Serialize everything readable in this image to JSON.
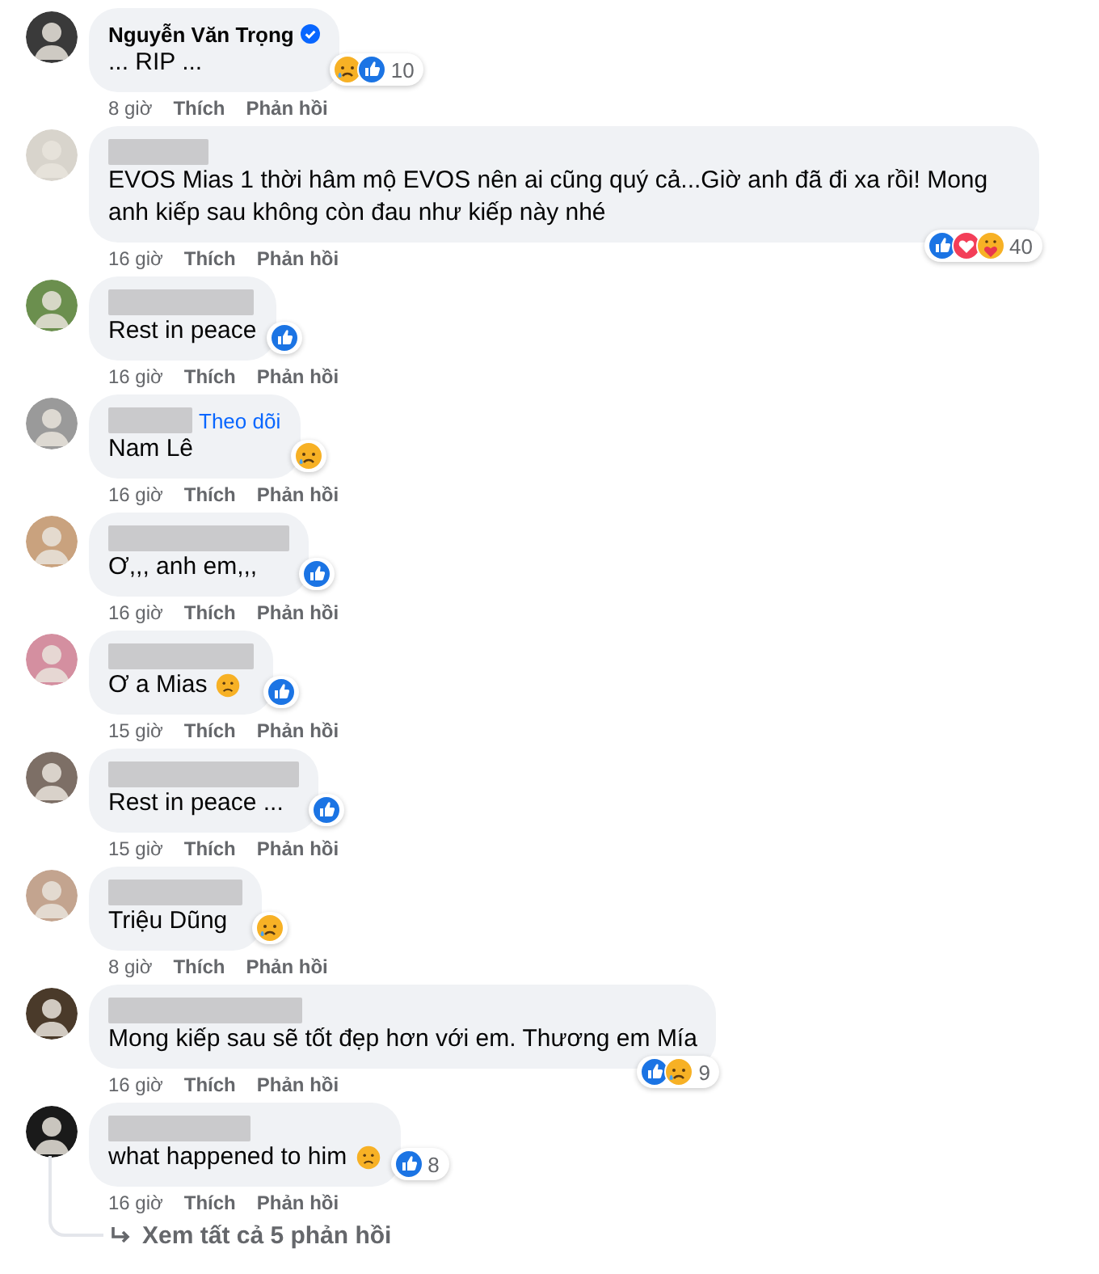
{
  "comments": [
    {
      "name_hidden": false,
      "author": "Nguyễn Văn Trọng",
      "verified": true,
      "text": "... RIP ...",
      "reactions": {
        "below_bubble": false,
        "icons": [
          {
            "kind": "sad"
          },
          {
            "kind": "like"
          }
        ],
        "count": "10"
      },
      "time": "8 giờ",
      "like": "Thích",
      "reply": "Phản hồi"
    },
    {
      "name_hidden": true,
      "text": "EVOS Mias 1 thời hâm mộ EVOS nên ai cũng quý cả...Giờ anh đã đi xa rồi! Mong anh kiếp sau không còn đau như kiếp này nhé",
      "reactions": {
        "below_bubble": true,
        "icons": [
          {
            "kind": "like"
          },
          {
            "kind": "love"
          },
          {
            "kind": "care"
          }
        ],
        "count": "40"
      },
      "time": "16 giờ",
      "like": "Thích",
      "reply": "Phản hồi"
    },
    {
      "name_hidden": true,
      "text": "Rest in peace",
      "reactions": {
        "below_bubble": false,
        "icons": [
          {
            "kind": "like"
          }
        ]
      },
      "time": "16 giờ",
      "like": "Thích",
      "reply": "Phản hồi"
    },
    {
      "name_hidden": true,
      "follow": "Theo dõi",
      "text": "Nam Lê",
      "reactions": {
        "below_bubble": false,
        "icons": [
          {
            "kind": "sad"
          }
        ]
      },
      "time": "16 giờ",
      "like": "Thích",
      "reply": "Phản hồi"
    },
    {
      "name_hidden": true,
      "text": "Ơ,,, anh em,,,",
      "reactions": {
        "below_bubble": false,
        "icons": [
          {
            "kind": "like"
          }
        ]
      },
      "time": "16 giờ",
      "like": "Thích",
      "reply": "Phản hồi"
    },
    {
      "name_hidden": true,
      "text": "Ơ a Mias",
      "emoji": {
        "kind": "frown"
      },
      "reactions": {
        "below_bubble": false,
        "icons": [
          {
            "kind": "like"
          }
        ]
      },
      "time": "15 giờ",
      "like": "Thích",
      "reply": "Phản hồi"
    },
    {
      "name_hidden": true,
      "text": "Rest in peace ...",
      "reactions": {
        "below_bubble": false,
        "icons": [
          {
            "kind": "like"
          }
        ]
      },
      "time": "15 giờ",
      "like": "Thích",
      "reply": "Phản hồi"
    },
    {
      "name_hidden": true,
      "text": "Triệu Dũng",
      "reactions": {
        "below_bubble": false,
        "icons": [
          {
            "kind": "sad"
          }
        ]
      },
      "time": "8 giờ",
      "like": "Thích",
      "reply": "Phản hồi"
    },
    {
      "name_hidden": true,
      "text": "Mong kiếp sau sẽ tốt đẹp hơn với em. Thương em Mía",
      "reactions": {
        "below_bubble": true,
        "icons": [
          {
            "kind": "like"
          },
          {
            "kind": "sad"
          }
        ],
        "count": "9"
      },
      "time": "16 giờ",
      "like": "Thích",
      "reply": "Phản hồi"
    },
    {
      "name_hidden": true,
      "text": "what happened to him",
      "emoji": {
        "kind": "frown"
      },
      "reactions": {
        "below_bubble": false,
        "icons": [
          {
            "kind": "like"
          }
        ],
        "count": "8"
      },
      "time": "16 giờ",
      "like": "Thích",
      "reply": "Phản hồi"
    }
  ],
  "view_replies": "Xem tất cả 5 phản hồi"
}
